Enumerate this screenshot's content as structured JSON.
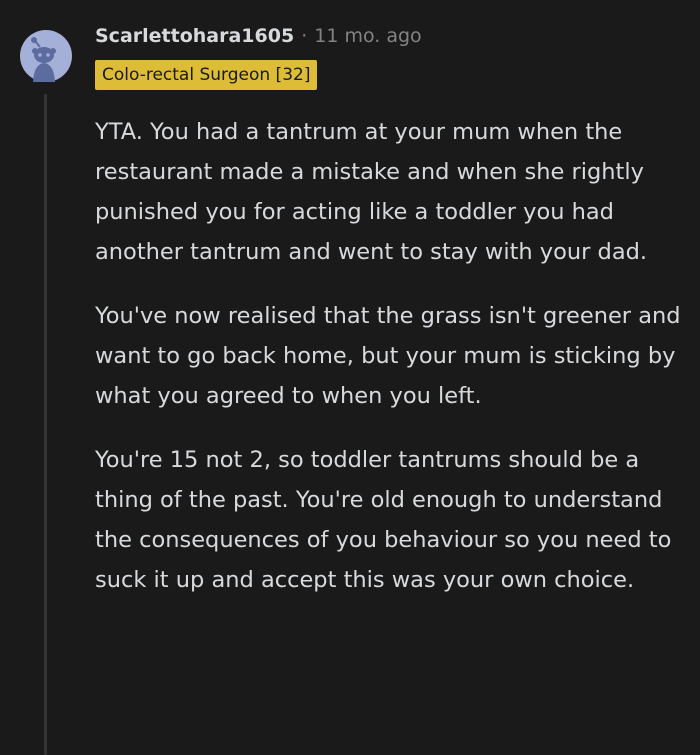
{
  "comment": {
    "username": "Scarlettohara1605",
    "separator": "·",
    "timestamp": "11 mo. ago",
    "flair": "Colo-rectal Surgeon [32]",
    "paragraphs": [
      "YTA. You had a tantrum at your mum when the restaurant made a mistake and when she rightly punished you for acting like a toddler you had another tantrum and went to stay with your dad.",
      "You've now realised that the grass isn't greener and want to go back home, but your mum is sticking by what you agreed to when you left.",
      "You're 15 not 2, so toddler tantrums should be a thing of the past. You're old enough to understand the consequences of you behaviour so you need to suck it up and accept this was your own choice."
    ]
  },
  "icons": {
    "avatar": "reddit-snoo-avatar-icon"
  },
  "colors": {
    "background": "#1a1a1b",
    "text": "#d7dadc",
    "meta": "#818384",
    "flair_bg": "#ddbd37",
    "avatar_bg": "#a5b0d8",
    "snoo_body": "#5c6c9e"
  }
}
